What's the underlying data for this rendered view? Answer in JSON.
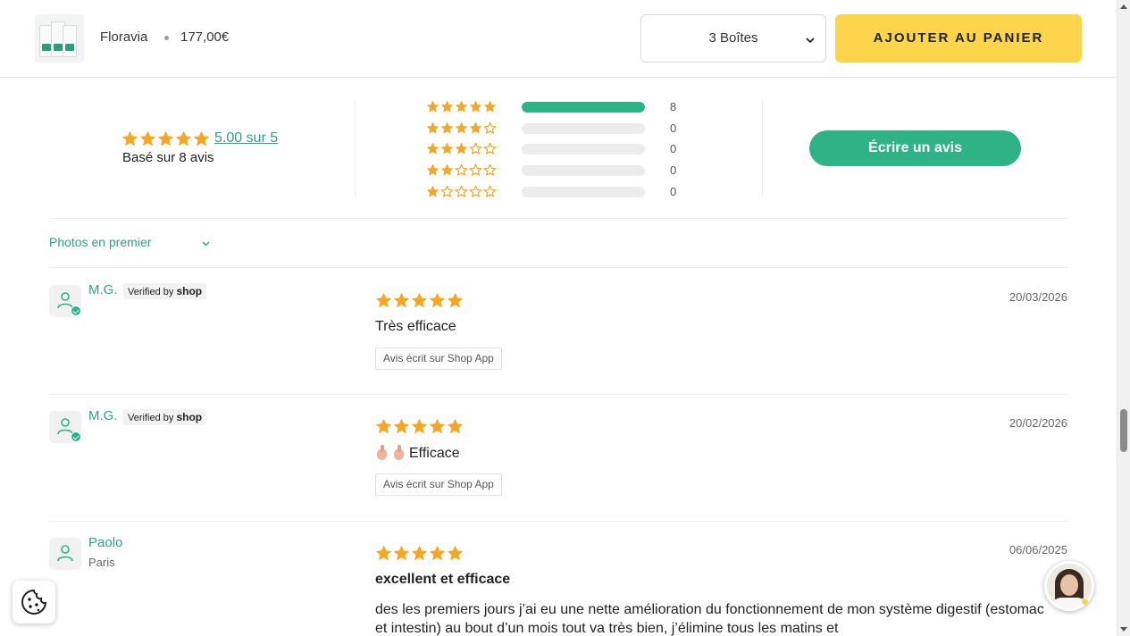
{
  "sticky_bar": {
    "product_name": "Floravia",
    "price": "177,00€",
    "variant_selected": "3 Boîtes",
    "add_to_cart_label": "AJOUTER AU PANIER"
  },
  "summary": {
    "average_link": "5.00 sur 5",
    "based_on": "Basé sur 8 avis",
    "average_rating": 5,
    "histogram": [
      {
        "stars": 5,
        "count": "8",
        "fraction": 1.0
      },
      {
        "stars": 4,
        "count": "0",
        "fraction": 0
      },
      {
        "stars": 3,
        "count": "0",
        "fraction": 0
      },
      {
        "stars": 2,
        "count": "0",
        "fraction": 0
      },
      {
        "stars": 1,
        "count": "0",
        "fraction": 0
      }
    ],
    "write_review_label": "Écrire un avis"
  },
  "sort": {
    "label": "Photos en premier"
  },
  "reviews": [
    {
      "author": "M.G.",
      "verified_prefix": "Verified by",
      "verified_brand": "shop",
      "rating": 5,
      "date": "20/03/2026",
      "title": "Très efficace",
      "source": "Avis écrit sur Shop App"
    },
    {
      "author": "M.G.",
      "verified_prefix": "Verified by",
      "verified_brand": "shop",
      "rating": 5,
      "date": "20/02/2026",
      "title": "Efficace",
      "source": "Avis écrit sur Shop App"
    },
    {
      "author": "Paolo",
      "location": "Paris",
      "rating": 5,
      "date": "06/06/2025",
      "title": "excellent et efficace",
      "body": "des les premiers jours j’ai eu une nette amélioration du fonctionnement de mon système digestif (estomac et intestin) au bout d’un mois tout va très bien, j’élimine tous les matins et"
    }
  ],
  "colors": {
    "accent": "#2fb386",
    "star": "#f5a623",
    "cart_button": "#fdd54c"
  }
}
